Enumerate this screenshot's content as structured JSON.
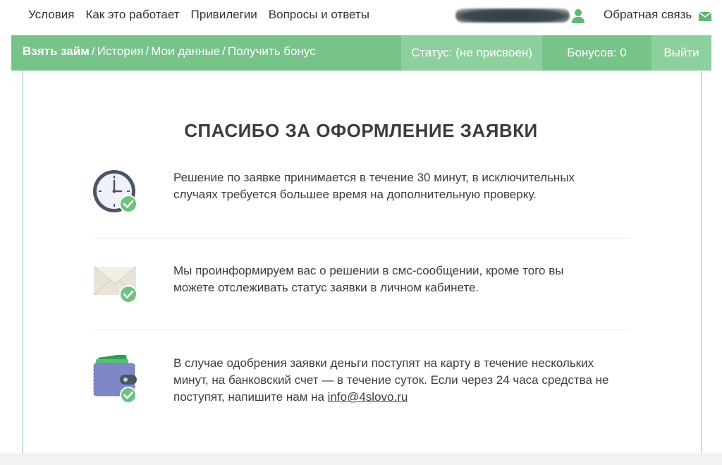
{
  "top_nav": {
    "links": [
      "Условия",
      "Как это работает",
      "Привилегии",
      "Вопросы и ответы"
    ],
    "feedback": "Обратная связь"
  },
  "green_bar": {
    "crumbs": [
      "Взять займ",
      "История",
      "Мои данные",
      "Получить бонус"
    ],
    "separator": "/",
    "status": "Статус: (не присвоен)",
    "bonus": "Бонусов: 0",
    "logout": "Выйти"
  },
  "main": {
    "title": "СПАСИБО ЗА ОФОРМЛЕНИЕ ЗАЯВКИ",
    "items": [
      {
        "icon": "clock-icon",
        "line1": "Решение по заявке принимается в течение 30 минут, в исключительных",
        "line2": "случаях требуется большее время на дополнительную проверку."
      },
      {
        "icon": "envelope-icon",
        "line1": "Мы проинформируем вас о решении в смс-сообщении, кроме того вы",
        "line2": "можете отслеживать статус заявки в личном кабинете."
      },
      {
        "icon": "wallet-icon",
        "line1": "В случае одобрения заявки деньги поступят на карту в течение нескольких",
        "line2": "минут, на банковский счет — в течение суток. Если через 24 часа средства не",
        "line3_prefix": "поступят, напишите нам на ",
        "email": "info@4slovo.ru"
      }
    ]
  },
  "colors": {
    "accent_green": "#77c38a",
    "light_green": "#8ecf9e",
    "check_green": "#6cc27e"
  }
}
